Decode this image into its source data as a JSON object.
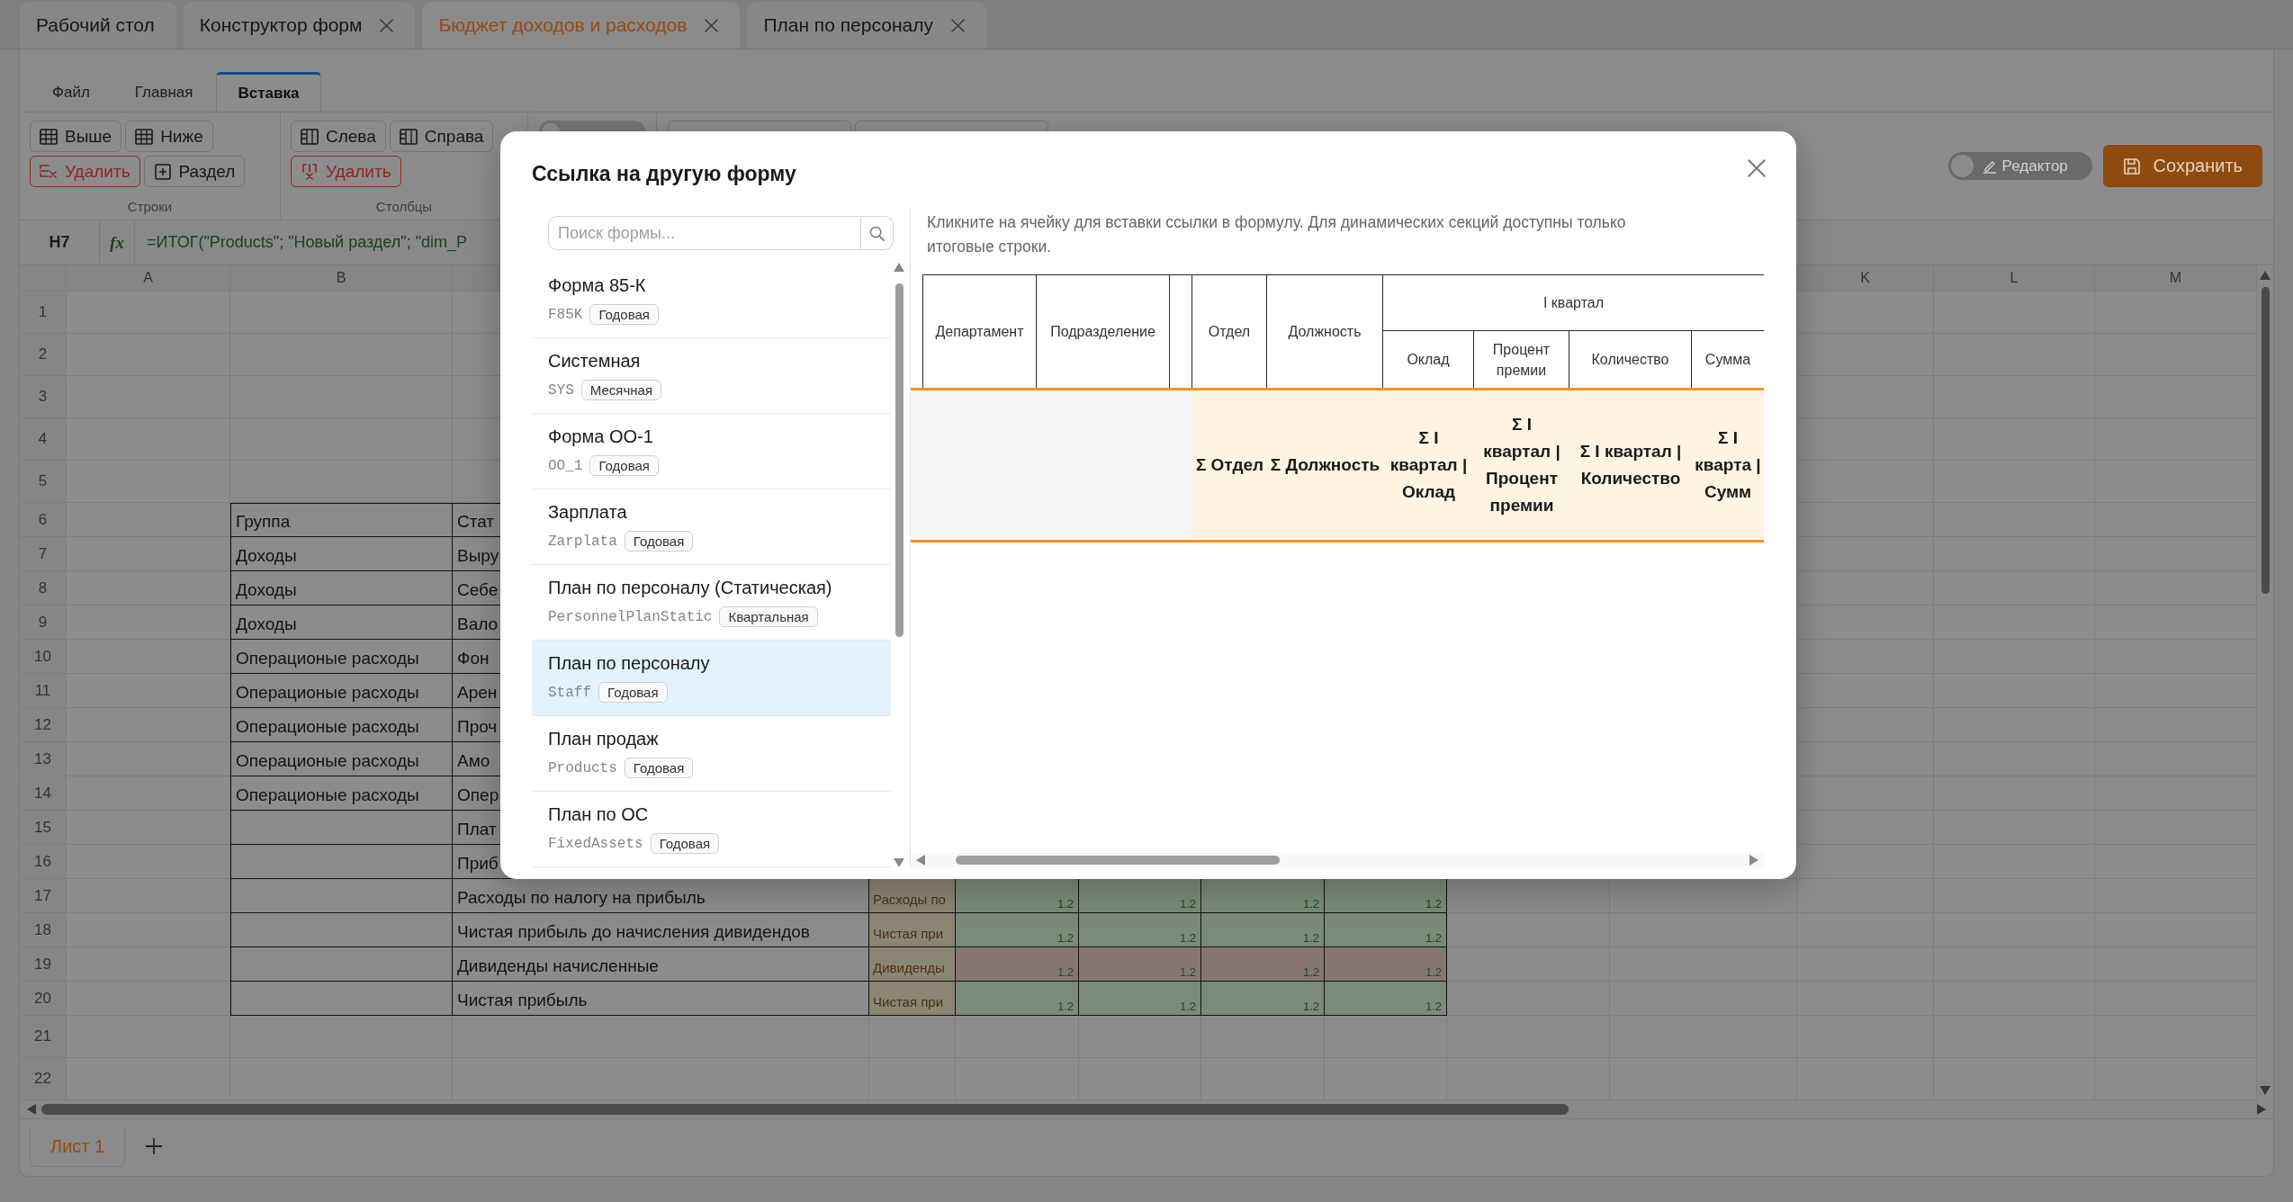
{
  "app_tabs": [
    {
      "label": "Рабочий стол",
      "closable": false,
      "selected": false
    },
    {
      "label": "Конструктор форм",
      "closable": true,
      "selected": false
    },
    {
      "label": "Бюджет доходов и расходов",
      "closable": true,
      "selected": true
    },
    {
      "label": "План по персоналу",
      "closable": true,
      "selected": false
    }
  ],
  "ribbon": {
    "tabs": [
      {
        "label": "Файл",
        "selected": false
      },
      {
        "label": "Главная",
        "selected": false
      },
      {
        "label": "Вставка",
        "selected": true
      }
    ],
    "groups": [
      {
        "kind": "buttons",
        "label": "Строки",
        "buttons": [
          {
            "kind": "row-above",
            "label": "Выше",
            "danger": false
          },
          {
            "kind": "row-below",
            "label": "Ниже",
            "danger": false
          },
          {
            "kind": "row-delete",
            "label": "Удалить",
            "danger": true
          },
          {
            "kind": "section",
            "label": "Раздел",
            "danger": false
          }
        ]
      },
      {
        "kind": "buttons",
        "label": "Столбцы",
        "buttons": [
          {
            "kind": "col-left",
            "label": "Слева",
            "danger": false
          },
          {
            "kind": "col-right",
            "label": "Справа",
            "danger": false
          },
          {
            "kind": "col-delete",
            "label": "Удалить",
            "danger": true
          }
        ]
      },
      {
        "kind": "covered-switch",
        "on": false
      },
      {
        "kind": "covered-buttons"
      }
    ]
  },
  "editor_toggle": {
    "label": "Редактор",
    "on": false
  },
  "save_button": {
    "label": "Сохранить"
  },
  "formula_bar": {
    "cell": "H7",
    "fx": "fx",
    "formula": "=ИТОГ(\"Products\"; \"Новый раздел\"; \"dim_P"
  },
  "sheet": {
    "column_headers": [
      "A",
      "B",
      "K",
      "L",
      "M"
    ],
    "rows": [
      {
        "number": "1"
      },
      {
        "number": "2"
      },
      {
        "number": "3"
      },
      {
        "number": "4"
      },
      {
        "number": "5"
      },
      {
        "number": "6",
        "group": "Группа",
        "item": "Стат"
      },
      {
        "number": "7",
        "group": "Доходы",
        "item": "Выру"
      },
      {
        "number": "8",
        "group": "Доходы",
        "item": "Себе"
      },
      {
        "number": "9",
        "group": "Доходы",
        "item": "Вало"
      },
      {
        "number": "10",
        "group": "Операционые расходы",
        "item": "Фон"
      },
      {
        "number": "11",
        "group": "Операционые расходы",
        "item": "Арен"
      },
      {
        "number": "12",
        "group": "Операционые расходы",
        "item": "Проч"
      },
      {
        "number": "13",
        "group": "Операционые расходы",
        "item": "Амо"
      },
      {
        "number": "14",
        "group": "Операционые расходы",
        "item": "Опер"
      },
      {
        "number": "15",
        "item": "Плат"
      },
      {
        "number": "16",
        "item": "Приб"
      },
      {
        "number": "17",
        "item": "Расходы по налогу на прибыль",
        "source": "Расходы по",
        "values": [
          "1.2",
          "1.2",
          "1.2",
          "1.2"
        ],
        "color": "#7b8a7a"
      },
      {
        "number": "18",
        "item": "Чистая прибыль до начисления дивидендов",
        "source": "Чистая при",
        "values": [
          "1.2",
          "1.2",
          "1.2",
          "1.2"
        ],
        "color": "#7b8a7a"
      },
      {
        "number": "19",
        "item": "Дивиденды начисленные",
        "source": "Дивиденды",
        "values": [
          "1.2",
          "1.2",
          "1.2",
          "1.2"
        ],
        "color": "#857672"
      },
      {
        "number": "20",
        "item": "Чистая прибыль",
        "source": "Чистая при",
        "values": [
          "1.2",
          "1.2",
          "1.2",
          "1.2"
        ],
        "color": "#7b8a7a"
      },
      {
        "number": "21"
      },
      {
        "number": "22"
      }
    ],
    "tabs": [
      {
        "label": "Лист 1",
        "selected": true
      }
    ]
  },
  "modal": {
    "title": "Ссылка на другую форму",
    "search": {
      "placeholder": "Поиск формы..."
    },
    "forms": [
      {
        "name": "Форма 85-К",
        "code": "F85K",
        "period": "Годовая",
        "selected": false
      },
      {
        "name": "Системная",
        "code": "SYS",
        "period": "Месячная",
        "selected": false
      },
      {
        "name": "Форма ОО-1",
        "code": "OO_1",
        "period": "Годовая",
        "selected": false
      },
      {
        "name": "Зарплата",
        "code": "Zarplata",
        "period": "Годовая",
        "selected": false
      },
      {
        "name": "План по персоналу (Статическая)",
        "code": "PersonnelPlanStatic",
        "period": "Квартальная",
        "selected": false
      },
      {
        "name": "План по персоналу",
        "code": "Staff",
        "period": "Годовая",
        "selected": true
      },
      {
        "name": "План продаж",
        "code": "Products",
        "period": "Годовая",
        "selected": false
      },
      {
        "name": "План по ОС",
        "code": "FixedAssets",
        "period": "Годовая",
        "selected": false
      }
    ],
    "hint": "Кликните на ячейку для вставки ссылки в формулу. Для динамических секций доступны только итоговые строки.",
    "preview": {
      "columns": [
        {
          "kind": "dimension",
          "label": "Департамент"
        },
        {
          "kind": "dimension",
          "label": "Подразделение"
        },
        {
          "kind": "spacer"
        },
        {
          "kind": "dimension",
          "label": "Отдел",
          "total": "Σ Отдел"
        },
        {
          "kind": "dimension",
          "label": "Должность",
          "total": "Σ Должность"
        }
      ],
      "period": {
        "label": "I квартал",
        "measures": [
          {
            "label": "Оклад",
            "total": "Σ I квартал | Оклад"
          },
          {
            "label": "Процент премии",
            "total": "Σ I квартал | Процент премии"
          },
          {
            "label": "Количество",
            "total": "Σ I квартал | Количество"
          },
          {
            "label": "Сумма",
            "total": "Σ I кварта | Сумм"
          }
        ]
      }
    }
  }
}
